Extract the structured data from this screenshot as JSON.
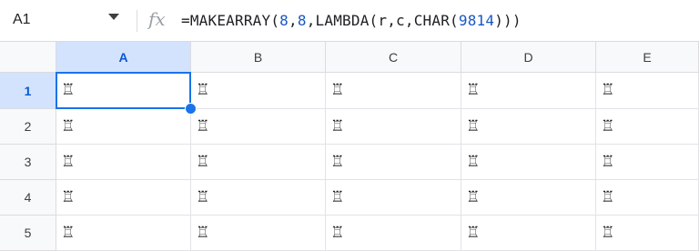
{
  "name_box": {
    "ref": "A1"
  },
  "formula_bar": {
    "fx_label": "fx",
    "parts": [
      "=MAKEARRAY(",
      "8",
      ",",
      "8",
      ",LAMBDA(r,c,CHAR(",
      "9814",
      ")))"
    ]
  },
  "columns": [
    "A",
    "B",
    "C",
    "D",
    "E"
  ],
  "rows": [
    {
      "label": "1",
      "cells": [
        "♖",
        "♖",
        "♖",
        "♖",
        "♖"
      ]
    },
    {
      "label": "2",
      "cells": [
        "♖",
        "♖",
        "♖",
        "♖",
        "♖"
      ]
    },
    {
      "label": "3",
      "cells": [
        "♖",
        "♖",
        "♖",
        "♖",
        "♖"
      ]
    },
    {
      "label": "4",
      "cells": [
        "♖",
        "♖",
        "♖",
        "♖",
        "♖"
      ]
    },
    {
      "label": "5",
      "cells": [
        "♖",
        "♖",
        "♖",
        "♖",
        "♖"
      ]
    }
  ],
  "selection": {
    "cell": "A1"
  },
  "colors": {
    "accent": "#1a73e8",
    "header_selected": "#d3e3fd",
    "number_token": "#1a56c6"
  }
}
